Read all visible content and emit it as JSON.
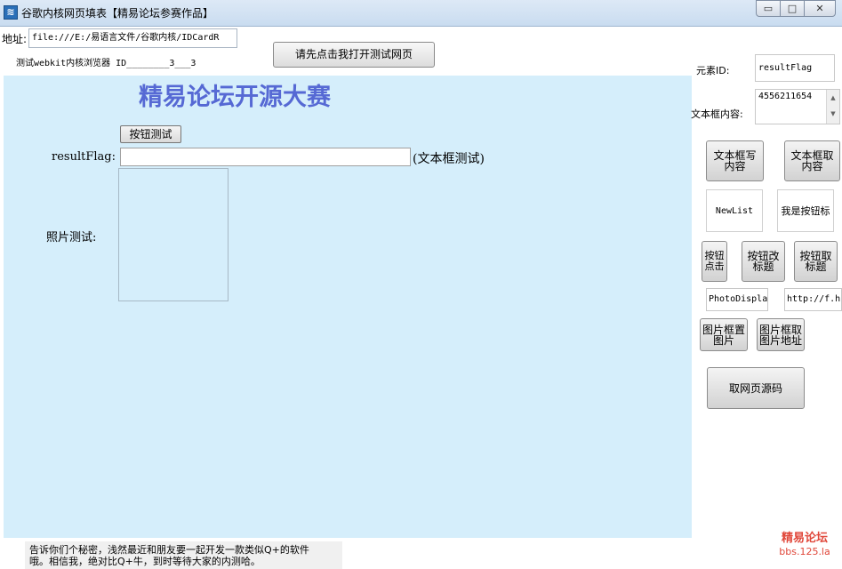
{
  "window": {
    "title": "谷歌内核网页填表【精易论坛参赛作品】",
    "icon": "app-icon",
    "controls": {
      "minimize": "▭",
      "maximize": "□",
      "close": "✕"
    }
  },
  "address_bar": {
    "label": "地址:",
    "value": "file:///E:/易语言文件/谷歌内核/IDCardR"
  },
  "toolbar": {
    "open_page_label": "请先点击我打开测试网页",
    "browser_info": "测试webkit内核浏览器 ID________3___3"
  },
  "webpage": {
    "heading": "精易论坛开源大赛",
    "button_test_label": "按钮测试",
    "resultflag_label": "resultFlag:",
    "resultflag_value": "",
    "textbox_test_note": "(文本框测试)",
    "photo_label": "照片测试:"
  },
  "footer": {
    "note_line1": "告诉你们个秘密，浅然最近和朋友要一起开发一款类似Q+的软件",
    "note_line2": "哦。相信我，绝对比Q+牛，到时等待大家的内测哈。"
  },
  "right_panel": {
    "element_id_label": "元素ID:",
    "element_id_value": "resultFlag",
    "textbox_content_label": "文本框内容:",
    "textbox_content_value": "4556211654",
    "write_textbox_line1": "文本框写",
    "write_textbox_line2": "内容",
    "read_textbox_line1": "文本框取",
    "read_textbox_line2": "内容",
    "newlist_text": "NewList",
    "i_am_button_text": "我是按钮标",
    "click_line1": "按钮",
    "click_line2": "点击",
    "change_title_line1": "按钮改",
    "change_title_line2": "标题",
    "get_title_line1": "按钮取",
    "get_title_line2": "标题",
    "photo_display_value": "PhotoDisplay",
    "url_value": "http://f.hi",
    "set_image_line1": "图片框置",
    "set_image_line2": "图片",
    "get_image_line1": "图片框取",
    "get_image_line2": "图片地址",
    "get_source_label": "取网页源码"
  },
  "watermark": {
    "name": "精易论坛",
    "url": "bbs.125.la"
  },
  "colors": {
    "webview_background": "#d5eefb",
    "heading": "#5669d4",
    "watermark": "#e0473a"
  }
}
